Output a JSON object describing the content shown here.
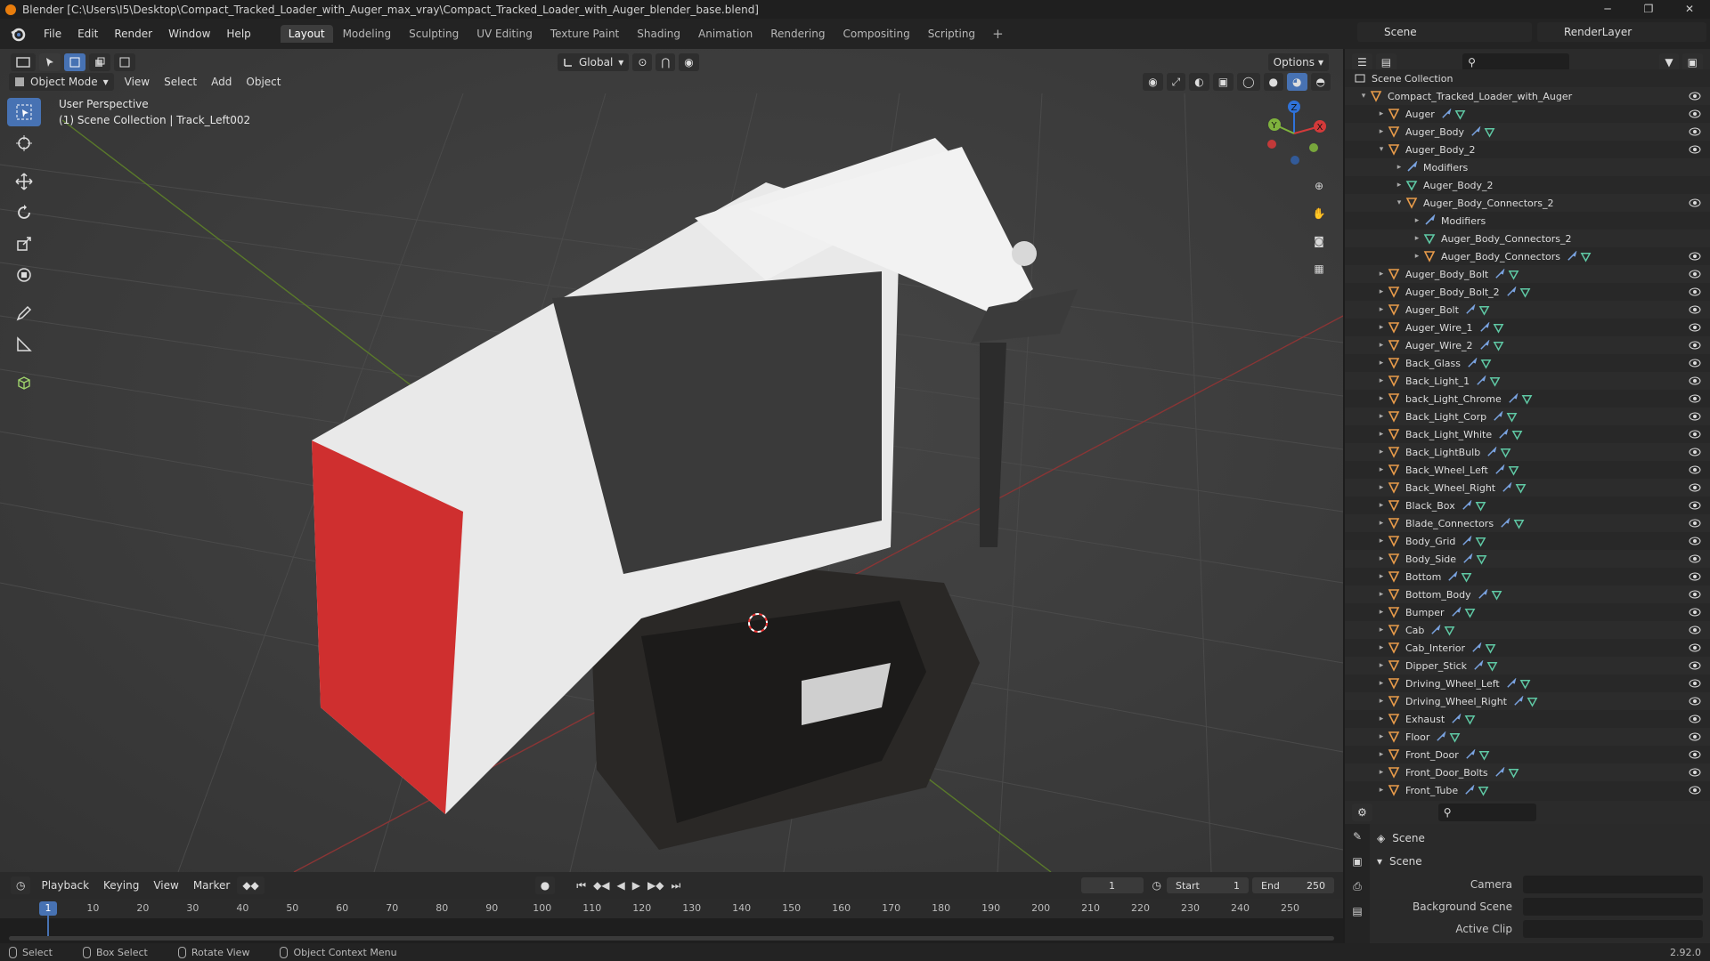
{
  "titlebar": {
    "title": "Blender [C:\\Users\\I5\\Desktop\\Compact_Tracked_Loader_with_Auger_max_vray\\Compact_Tracked_Loader_with_Auger_blender_base.blend]",
    "minimize": "─",
    "maximize": "❐",
    "close": "✕"
  },
  "menubar": {
    "menus": [
      "File",
      "Edit",
      "Render",
      "Window",
      "Help"
    ],
    "workspaces": [
      "Layout",
      "Modeling",
      "Sculpting",
      "UV Editing",
      "Texture Paint",
      "Shading",
      "Animation",
      "Rendering",
      "Compositing",
      "Scripting"
    ],
    "active_workspace": "Layout",
    "add_tab": "+",
    "scene": "Scene",
    "view_layer": "RenderLayer"
  },
  "viewport_header": {
    "transform_orientation": "Global",
    "options_label": "Options"
  },
  "viewport_menu": {
    "mode": "Object Mode",
    "menus": [
      "View",
      "Select",
      "Add",
      "Object"
    ]
  },
  "viewport": {
    "perspective": "User Perspective",
    "context": "(1) Scene Collection | Track_Left002",
    "gizmo_labels": {
      "x": "X",
      "y": "Y",
      "z": "Z"
    },
    "accent": "#4772b3"
  },
  "outliner": {
    "root": "Scene Collection",
    "collection": "Compact_Tracked_Loader_with_Auger",
    "rows": [
      {
        "label": "Auger",
        "indent": 1,
        "arrow": "▸",
        "type": "obj",
        "wrench": true,
        "mesh": true,
        "eye": true
      },
      {
        "label": "Auger_Body",
        "indent": 1,
        "arrow": "▸",
        "type": "obj",
        "wrench": true,
        "mesh": true,
        "eye": true
      },
      {
        "label": "Auger_Body_2",
        "indent": 1,
        "arrow": "▾",
        "type": "obj",
        "wrench": false,
        "mesh": false,
        "eye": true
      },
      {
        "label": "Modifiers",
        "indent": 2,
        "arrow": "▸",
        "type": "mod",
        "wrench": false,
        "mesh": false,
        "eye": false
      },
      {
        "label": "Auger_Body_2",
        "indent": 2,
        "arrow": "▸",
        "type": "meshdata",
        "wrench": false,
        "mesh": false,
        "eye": false
      },
      {
        "label": "Auger_Body_Connectors_2",
        "indent": 2,
        "arrow": "▾",
        "type": "obj",
        "wrench": false,
        "mesh": false,
        "eye": true
      },
      {
        "label": "Modifiers",
        "indent": 3,
        "arrow": "▸",
        "type": "mod",
        "wrench": false,
        "mesh": false,
        "eye": false
      },
      {
        "label": "Auger_Body_Connectors_2",
        "indent": 3,
        "arrow": "▸",
        "type": "meshdata",
        "wrench": false,
        "mesh": false,
        "eye": false
      },
      {
        "label": "Auger_Body_Connectors",
        "indent": 3,
        "arrow": "▸",
        "type": "obj",
        "wrench": true,
        "mesh": true,
        "eye": true
      },
      {
        "label": "Auger_Body_Bolt",
        "indent": 1,
        "arrow": "▸",
        "type": "obj",
        "wrench": true,
        "mesh": true,
        "eye": true
      },
      {
        "label": "Auger_Body_Bolt_2",
        "indent": 1,
        "arrow": "▸",
        "type": "obj",
        "wrench": true,
        "mesh": true,
        "eye": true
      },
      {
        "label": "Auger_Bolt",
        "indent": 1,
        "arrow": "▸",
        "type": "obj",
        "wrench": true,
        "mesh": true,
        "eye": true
      },
      {
        "label": "Auger_Wire_1",
        "indent": 1,
        "arrow": "▸",
        "type": "obj",
        "wrench": true,
        "mesh": true,
        "eye": true
      },
      {
        "label": "Auger_Wire_2",
        "indent": 1,
        "arrow": "▸",
        "type": "obj",
        "wrench": true,
        "mesh": true,
        "eye": true
      },
      {
        "label": "Back_Glass",
        "indent": 1,
        "arrow": "▸",
        "type": "obj",
        "wrench": true,
        "mesh": true,
        "eye": true
      },
      {
        "label": "Back_Light_1",
        "indent": 1,
        "arrow": "▸",
        "type": "obj",
        "wrench": true,
        "mesh": true,
        "eye": true
      },
      {
        "label": "back_Light_Chrome",
        "indent": 1,
        "arrow": "▸",
        "type": "obj",
        "wrench": true,
        "mesh": true,
        "eye": true
      },
      {
        "label": "Back_Light_Corp",
        "indent": 1,
        "arrow": "▸",
        "type": "obj",
        "wrench": true,
        "mesh": true,
        "eye": true
      },
      {
        "label": "Back_Light_White",
        "indent": 1,
        "arrow": "▸",
        "type": "obj",
        "wrench": true,
        "mesh": true,
        "eye": true
      },
      {
        "label": "Back_LightBulb",
        "indent": 1,
        "arrow": "▸",
        "type": "obj",
        "wrench": true,
        "mesh": true,
        "eye": true
      },
      {
        "label": "Back_Wheel_Left",
        "indent": 1,
        "arrow": "▸",
        "type": "obj",
        "wrench": true,
        "mesh": true,
        "eye": true
      },
      {
        "label": "Back_Wheel_Right",
        "indent": 1,
        "arrow": "▸",
        "type": "obj",
        "wrench": true,
        "mesh": true,
        "eye": true
      },
      {
        "label": "Black_Box",
        "indent": 1,
        "arrow": "▸",
        "type": "obj",
        "wrench": true,
        "mesh": true,
        "eye": true
      },
      {
        "label": "Blade_Connectors",
        "indent": 1,
        "arrow": "▸",
        "type": "obj",
        "wrench": true,
        "mesh": true,
        "eye": true
      },
      {
        "label": "Body_Grid",
        "indent": 1,
        "arrow": "▸",
        "type": "obj",
        "wrench": true,
        "mesh": true,
        "eye": true
      },
      {
        "label": "Body_Side",
        "indent": 1,
        "arrow": "▸",
        "type": "obj",
        "wrench": true,
        "mesh": true,
        "eye": true
      },
      {
        "label": "Bottom",
        "indent": 1,
        "arrow": "▸",
        "type": "obj",
        "wrench": true,
        "mesh": true,
        "eye": true
      },
      {
        "label": "Bottom_Body",
        "indent": 1,
        "arrow": "▸",
        "type": "obj",
        "wrench": true,
        "mesh": true,
        "eye": true
      },
      {
        "label": "Bumper",
        "indent": 1,
        "arrow": "▸",
        "type": "obj",
        "wrench": true,
        "mesh": true,
        "eye": true
      },
      {
        "label": "Cab",
        "indent": 1,
        "arrow": "▸",
        "type": "obj",
        "wrench": true,
        "mesh": true,
        "eye": true
      },
      {
        "label": "Cab_Interior",
        "indent": 1,
        "arrow": "▸",
        "type": "obj",
        "wrench": true,
        "mesh": true,
        "eye": true
      },
      {
        "label": "Dipper_Stick",
        "indent": 1,
        "arrow": "▸",
        "type": "obj",
        "wrench": true,
        "mesh": true,
        "eye": true
      },
      {
        "label": "Driving_Wheel_Left",
        "indent": 1,
        "arrow": "▸",
        "type": "obj",
        "wrench": true,
        "mesh": true,
        "eye": true
      },
      {
        "label": "Driving_Wheel_Right",
        "indent": 1,
        "arrow": "▸",
        "type": "obj",
        "wrench": true,
        "mesh": true,
        "eye": true
      },
      {
        "label": "Exhaust",
        "indent": 1,
        "arrow": "▸",
        "type": "obj",
        "wrench": true,
        "mesh": true,
        "eye": true
      },
      {
        "label": "Floor",
        "indent": 1,
        "arrow": "▸",
        "type": "obj",
        "wrench": true,
        "mesh": true,
        "eye": true
      },
      {
        "label": "Front_Door",
        "indent": 1,
        "arrow": "▸",
        "type": "obj",
        "wrench": true,
        "mesh": true,
        "eye": true
      },
      {
        "label": "Front_Door_Bolts",
        "indent": 1,
        "arrow": "▸",
        "type": "obj",
        "wrench": true,
        "mesh": true,
        "eye": true
      },
      {
        "label": "Front_Tube",
        "indent": 1,
        "arrow": "▸",
        "type": "obj",
        "wrench": true,
        "mesh": true,
        "eye": true
      }
    ]
  },
  "properties": {
    "breadcrumb": "Scene",
    "panel": "Scene",
    "fields": [
      {
        "label": "Camera",
        "value": ""
      },
      {
        "label": "Background Scene",
        "value": ""
      },
      {
        "label": "Active Clip",
        "value": ""
      }
    ]
  },
  "timeline": {
    "menus": [
      "Playback",
      "Keying",
      "View",
      "Marker"
    ],
    "current_frame": "1",
    "start_label": "Start",
    "start": "1",
    "end_label": "End",
    "end": "250",
    "ticks": [
      "10",
      "20",
      "30",
      "40",
      "50",
      "60",
      "70",
      "80",
      "90",
      "100",
      "110",
      "120",
      "130",
      "140",
      "150",
      "160",
      "170",
      "180",
      "190",
      "200",
      "210",
      "220",
      "230",
      "240",
      "250"
    ],
    "playhead_label": "1"
  },
  "statusbar": {
    "items": [
      "Select",
      "Box Select",
      "Rotate View",
      "Object Context Menu"
    ],
    "version": "2.92.0"
  }
}
